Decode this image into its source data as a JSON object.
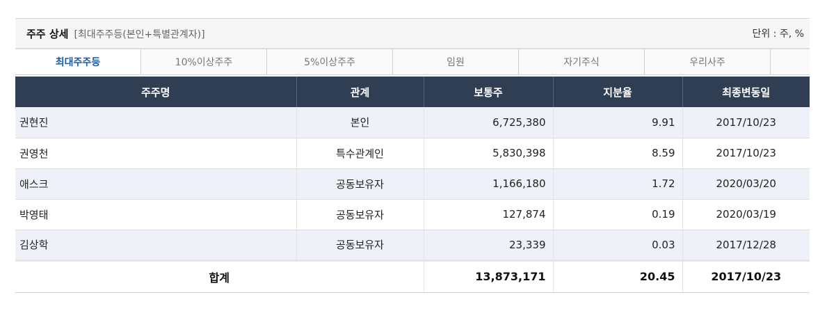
{
  "header": {
    "title": "주주 상세",
    "subtitle": "[최대주주등(본인+특별관계자)]",
    "unit": "단위 : 주, %"
  },
  "tabs": [
    {
      "label": "최대주주등",
      "active": true
    },
    {
      "label": "10%이상주주",
      "active": false
    },
    {
      "label": "5%이상주주",
      "active": false
    },
    {
      "label": "임원",
      "active": false
    },
    {
      "label": "자기주식",
      "active": false
    },
    {
      "label": "우리사주",
      "active": false
    }
  ],
  "table": {
    "columns": [
      "주주명",
      "관계",
      "보통주",
      "지분율",
      "최종변동일"
    ],
    "rows": [
      {
        "name": "권현진",
        "relation": "본인",
        "shares": "6,725,380",
        "ratio": "9.91",
        "date": "2017/10/23"
      },
      {
        "name": "권영천",
        "relation": "특수관계인",
        "shares": "5,830,398",
        "ratio": "8.59",
        "date": "2017/10/23"
      },
      {
        "name": "애스크",
        "relation": "공동보유자",
        "shares": "1,166,180",
        "ratio": "1.72",
        "date": "2020/03/20"
      },
      {
        "name": "박영태",
        "relation": "공동보유자",
        "shares": "127,874",
        "ratio": "0.19",
        "date": "2020/03/19"
      },
      {
        "name": "김상학",
        "relation": "공동보유자",
        "shares": "23,339",
        "ratio": "0.03",
        "date": "2017/12/28"
      }
    ],
    "total": {
      "label": "합계",
      "shares": "13,873,171",
      "ratio": "20.45",
      "date": "2017/10/23"
    }
  }
}
